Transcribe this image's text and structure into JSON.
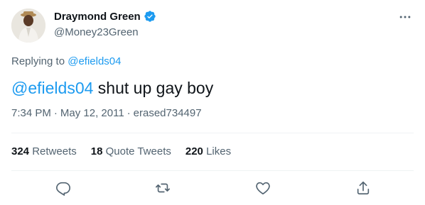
{
  "author": {
    "display_name": "Draymond Green",
    "handle": "@Money23Green",
    "verified": true,
    "verified_color": "#1d9bf0"
  },
  "reply": {
    "prefix": "Replying to ",
    "to": "@efields04"
  },
  "tweet": {
    "mention": "@efields04",
    "body": " shut up gay boy"
  },
  "meta": {
    "time": "7:34 PM",
    "sep1": "·",
    "date": "May 12, 2011",
    "sep2": "·",
    "source": "erased734497"
  },
  "stats": {
    "retweets_count": "324",
    "retweets_label": "Retweets",
    "quotes_count": "18",
    "quotes_label": "Quote Tweets",
    "likes_count": "220",
    "likes_label": "Likes"
  },
  "actions": {
    "reply_icon": "reply-icon",
    "retweet_icon": "retweet-icon",
    "like_icon": "like-icon",
    "share_icon": "share-icon"
  },
  "colors": {
    "link": "#1d9bf0",
    "secondary_text": "#536471",
    "primary_text": "#0f1419"
  }
}
